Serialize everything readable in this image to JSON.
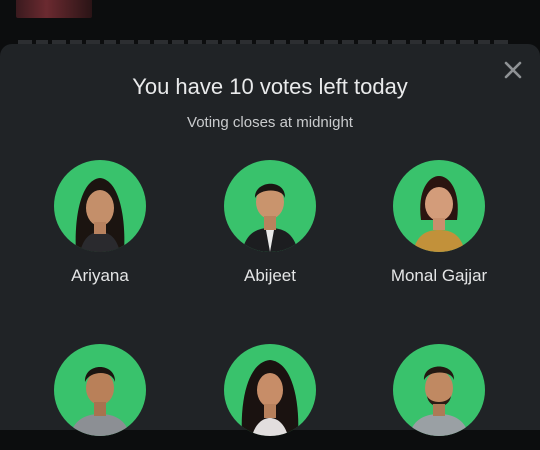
{
  "modal": {
    "title": "You have 10 votes left today",
    "subtitle": "Voting closes at midnight"
  },
  "colors": {
    "sheet_background": "#202326",
    "avatar_background": "#39c26c",
    "text": "#e9eaeb"
  },
  "contestants": [
    {
      "name": "Ariyana"
    },
    {
      "name": "Abijeet"
    },
    {
      "name": "Monal Gajjar"
    },
    {
      "name": ""
    },
    {
      "name": ""
    },
    {
      "name": ""
    }
  ]
}
